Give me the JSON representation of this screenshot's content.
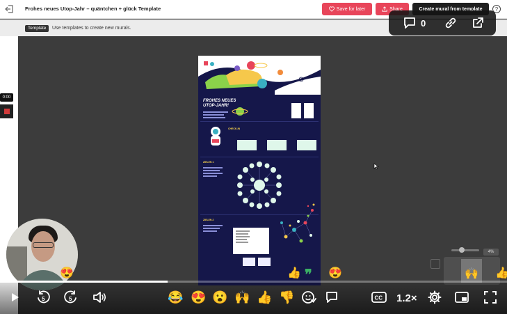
{
  "topbar": {
    "title": "Frohes neues Utop-Jahr – quäntchen + glück Template",
    "save_label": "Save for later",
    "share_label": "Share",
    "create_label": "Create mural from template",
    "help_label": "?"
  },
  "banner": {
    "tag": "Template",
    "text": "Use templates to create new murals."
  },
  "recorder": {
    "time": "0:00"
  },
  "board": {
    "heading_line1": "FROHES NEUES",
    "heading_line2": "UTOP-JAHR!",
    "section1": "CHECK-IN",
    "section2": "ZIELEN 1",
    "section3": "ZIELEN 2"
  },
  "float_toolbar": {
    "comment_count": "0"
  },
  "zoom": {
    "percent": "4%"
  },
  "video": {
    "progress_fraction": 0.33,
    "speed": "1.2×"
  },
  "reactions": [
    "😂",
    "😍",
    "😮",
    "🙌",
    "👍",
    "👎"
  ],
  "floating_reactions": [
    "😍",
    "👍",
    "❞",
    "😍",
    "🙌",
    "👍"
  ],
  "colors": {
    "accent": "#e8455a",
    "board_bg": "#15174a",
    "sticky": "#dff7ea"
  }
}
